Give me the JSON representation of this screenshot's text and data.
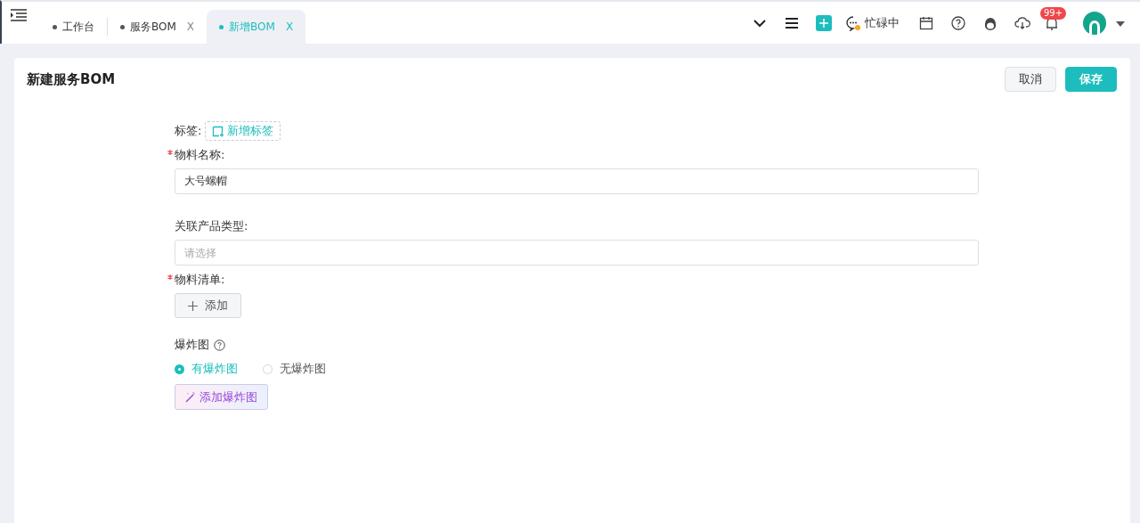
{
  "tabs": [
    {
      "label": "工作台",
      "selected": false
    },
    {
      "label": "服务BOM",
      "selected": false,
      "close": "X"
    },
    {
      "label": "新增BOM",
      "selected": true,
      "close": "X"
    }
  ],
  "header": {
    "status": "忙碌中",
    "badge": "99+"
  },
  "page": {
    "title": "新建服务BOM",
    "buttons": [
      {
        "label": "取消",
        "kind": "default"
      },
      {
        "label": "保存",
        "kind": "primary"
      }
    ]
  },
  "form": {
    "tag": {
      "label": "标签:",
      "button": "新增标签"
    },
    "fields": [
      {
        "kind": "input",
        "label": "物料名称:",
        "required": true,
        "value": "大号螺帽"
      },
      {
        "kind": "select",
        "label": "关联产品类型:",
        "required": false,
        "placeholder": "请选择"
      },
      {
        "kind": "add",
        "label": "物料清单:",
        "required": true,
        "button": "添加"
      }
    ],
    "explode": {
      "label": "爆炸图",
      "options": [
        {
          "label": "有爆炸图",
          "selected": true
        },
        {
          "label": "无爆炸图",
          "selected": false
        }
      ],
      "button": "添加爆炸图"
    }
  }
}
